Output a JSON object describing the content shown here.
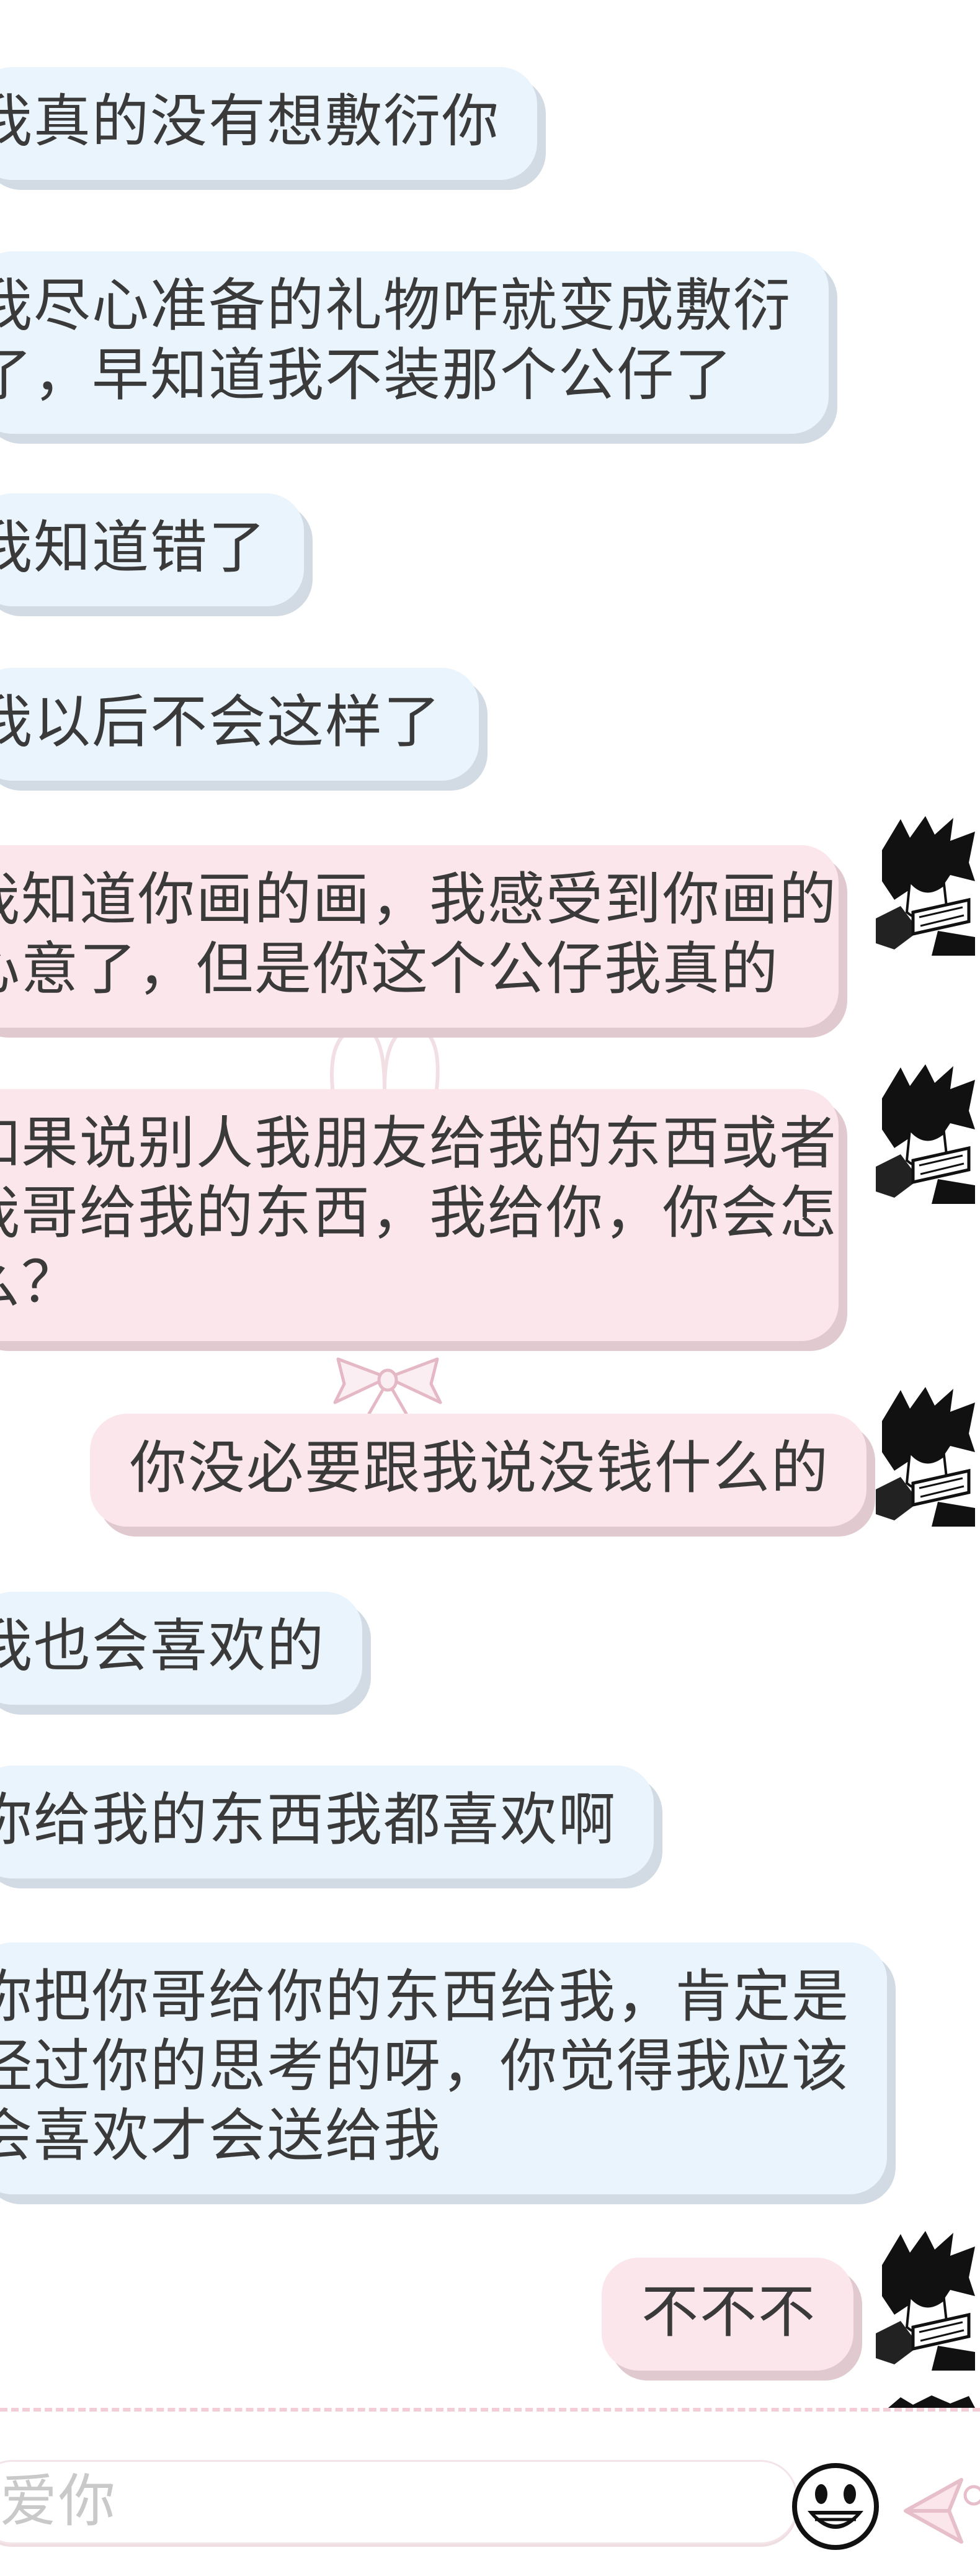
{
  "messages": [
    {
      "side": "left",
      "lines": [
        "我真的没有想敷衍你"
      ]
    },
    {
      "side": "left",
      "lines": [
        "我尽心准备的礼物咋就变成敷衍",
        "了，早知道我不装那个公仔了"
      ]
    },
    {
      "side": "left",
      "lines": [
        "我知道错了"
      ]
    },
    {
      "side": "left",
      "lines": [
        "我以后不会这样了"
      ]
    },
    {
      "side": "right",
      "lines": [
        "我知道你画的画，我感受到你画的",
        "心意了，但是你这个公仔我真的"
      ]
    },
    {
      "side": "right",
      "lines": [
        "如果说别人我朋友给我的东西或者",
        "我哥给我的东西，我给你，你会怎",
        "么？"
      ]
    },
    {
      "side": "right",
      "lines": [
        "你没必要跟我说没钱什么的"
      ]
    },
    {
      "side": "left",
      "lines": [
        "我也会喜欢的"
      ]
    },
    {
      "side": "left",
      "lines": [
        "你给我的东西我都喜欢啊"
      ]
    },
    {
      "side": "left",
      "lines": [
        "你把你哥给你的东西给我，肯定是",
        "经过你的思考的呀，你觉得我应该",
        "会喜欢才会送给我"
      ]
    },
    {
      "side": "right",
      "lines": [
        "不不不"
      ]
    }
  ],
  "input": {
    "text": "爱你"
  },
  "icons": {
    "avatar": "manga-avatar-icon",
    "emoji": "grin-emoji-icon",
    "send": "send-arrow-icon",
    "decoration": "bow-ribbon-icon"
  },
  "colors": {
    "left_bubble": "#eaf4fc",
    "right_bubble": "#fbe6ec",
    "text": "#3a3a3a",
    "input_placeholder": "#c9c9c9"
  }
}
